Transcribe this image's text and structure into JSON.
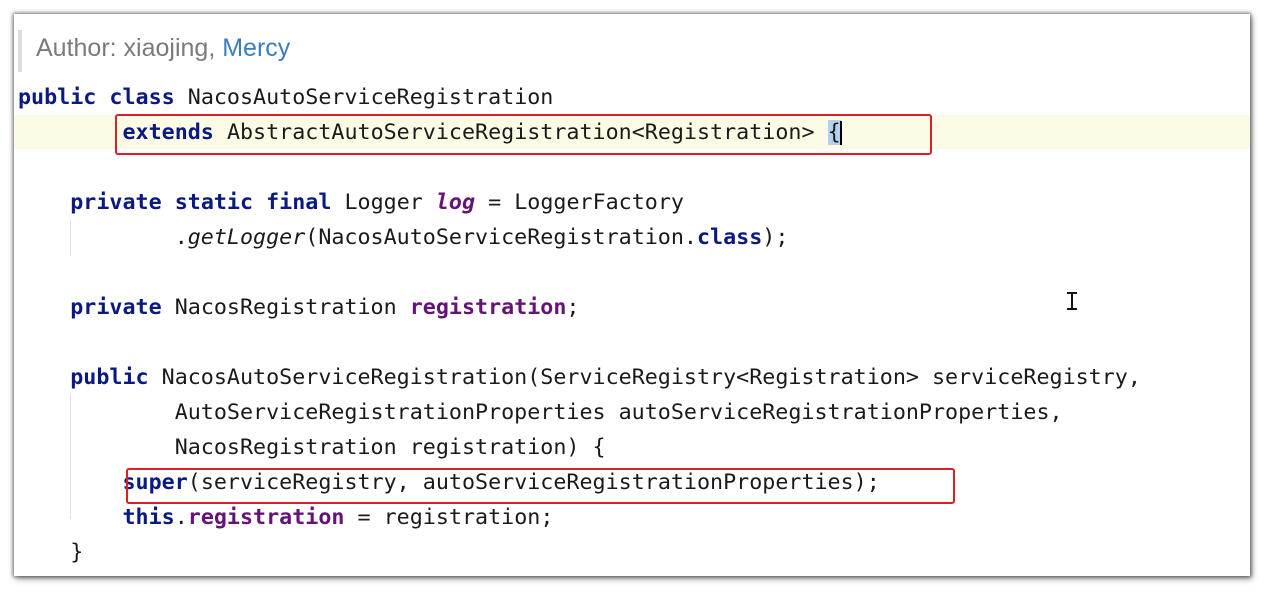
{
  "author": {
    "prefix": "Author: xiaojing, ",
    "link": "Mercy"
  },
  "code": {
    "line1": {
      "kw1": "public",
      "kw2": "class",
      "name": "NacosAutoServiceRegistration"
    },
    "line2": {
      "kw": "extends",
      "rest": "AbstractAutoServiceRegistration<Registration>",
      "brace": "{"
    },
    "line4": {
      "kw1": "private",
      "kw2": "static",
      "kw3": "final",
      "type": "Logger",
      "field": "log",
      "rest": "= LoggerFactory"
    },
    "line5": {
      "dot": ".",
      "method": "getLogger",
      "args": "(NacosAutoServiceRegistration.",
      "kw": "class",
      "end": ");"
    },
    "line7": {
      "kw": "private",
      "type": "NacosRegistration",
      "field": "registration",
      "end": ";"
    },
    "line9": {
      "kw": "public",
      "rest": "NacosAutoServiceRegistration(ServiceRegistry<Registration> serviceRegistry,"
    },
    "line10": {
      "text": "AutoServiceRegistrationProperties autoServiceRegistrationProperties,"
    },
    "line11": {
      "text": "NacosRegistration registration) {"
    },
    "line12": {
      "kw": "super",
      "rest": "(serviceRegistry, autoServiceRegistrationProperties);"
    },
    "line13": {
      "kw": "this",
      "dot": ".",
      "field": "registration",
      "rest": "= registration;"
    },
    "line14": {
      "text": "}"
    }
  },
  "colors": {
    "keyword": "#0a1a80",
    "field": "#66127a",
    "highlight_box": "#d6202a",
    "current_line": "#fbfbe6",
    "link": "#3a7dbf"
  }
}
